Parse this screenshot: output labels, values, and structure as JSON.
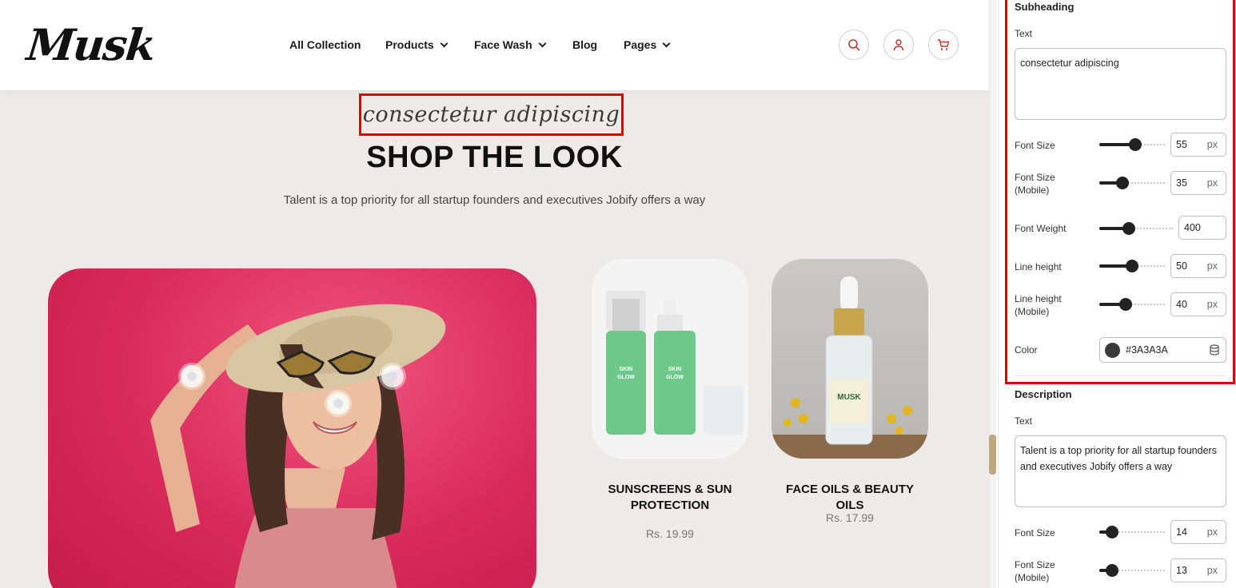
{
  "header": {
    "logo": "Musk",
    "nav": [
      {
        "label": "All Collection",
        "has_dropdown": false
      },
      {
        "label": "Products",
        "has_dropdown": true
      },
      {
        "label": "Face Wash",
        "has_dropdown": true
      },
      {
        "label": "Blog",
        "has_dropdown": false
      },
      {
        "label": "Pages",
        "has_dropdown": true
      }
    ],
    "icons": [
      "search-icon",
      "user-icon",
      "cart-icon"
    ],
    "accent": "#c0392b"
  },
  "section": {
    "subheading": "consectetur adipiscing",
    "title": "SHOP THE LOOK",
    "description": "Talent is a top priority for all startup founders and executives Jobify offers a way"
  },
  "products": [
    {
      "name": "SUNSCREENS & SUN PROTECTION",
      "price": "Rs. 19.99",
      "bottle_text": "SKIN GLOW BOTTLE"
    },
    {
      "name": "FACE OILS & BEAUTY OILS",
      "price": "Rs. 17.99",
      "bottle_text": "MUSK"
    }
  ],
  "panel": {
    "subheading": {
      "heading": "Subheading",
      "text_label": "Text",
      "text_value": "consectetur adipiscing",
      "font_size": {
        "label": "Font Size",
        "value": "55",
        "unit": "px",
        "level": 0.55
      },
      "font_size_mobile": {
        "label": "Font Size (Mobile)",
        "value": "35",
        "unit": "px",
        "level": 0.35
      },
      "font_weight": {
        "label": "Font Weight",
        "value": "400",
        "level": 0.4
      },
      "line_height": {
        "label": "Line height",
        "value": "50",
        "unit": "px",
        "level": 0.5
      },
      "line_height_mobile": {
        "label": "Line height (Mobile)",
        "value": "40",
        "unit": "px",
        "level": 0.4
      },
      "color": {
        "label": "Color",
        "value": "#3A3A3A"
      }
    },
    "description": {
      "heading": "Description",
      "text_label": "Text",
      "text_value": "Talent is a top priority for all startup founders and executives Jobify offers a way",
      "font_size": {
        "label": "Font Size",
        "value": "14",
        "unit": "px",
        "level": 0.2
      },
      "font_size_mobile": {
        "label": "Font Size (Mobile)",
        "value": "13",
        "unit": "px",
        "level": 0.2
      }
    }
  }
}
